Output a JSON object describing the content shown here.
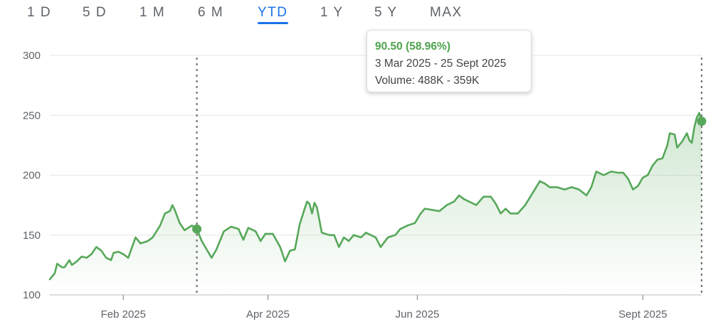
{
  "range_tabs": [
    {
      "label": "1 D"
    },
    {
      "label": "5 D"
    },
    {
      "label": "1 M"
    },
    {
      "label": "6 M"
    },
    {
      "label": "YTD"
    },
    {
      "label": "1 Y"
    },
    {
      "label": "5 Y"
    },
    {
      "label": "MAX"
    }
  ],
  "active_tab": "YTD",
  "tooltip": {
    "change": "90.50 (58.96%)",
    "date_range": "3 Mar 2025 - 25 Sept 2025",
    "volume": "Volume: 488K - 359K"
  },
  "colors": {
    "line": "#57a85a",
    "fill": "#57a85a",
    "accent": "#1a73e8",
    "grid": "#e6e6e6",
    "marker_line": "#757575"
  },
  "chart_data": {
    "type": "area",
    "title": "",
    "xlabel": "",
    "ylabel": "",
    "ylim": [
      100,
      300
    ],
    "yticks": [
      100,
      150,
      200,
      250,
      300
    ],
    "xlim": [
      "2025-01-02",
      "2025-09-25"
    ],
    "xticks": [
      {
        "date": "2025-02-01",
        "label": "Feb 2025"
      },
      {
        "date": "2025-04-01",
        "label": "Apr 2025"
      },
      {
        "date": "2025-06-01",
        "label": "Jun 2025"
      },
      {
        "date": "2025-09-01",
        "label": "Sept 2025"
      }
    ],
    "grid": true,
    "selection": {
      "start": "2025-03-03",
      "end": "2025-09-25"
    },
    "series": [
      {
        "points": [
          [
            "2025-01-02",
            113
          ],
          [
            "2025-01-04",
            118
          ],
          [
            "2025-01-05",
            126
          ],
          [
            "2025-01-07",
            123
          ],
          [
            "2025-01-08",
            123
          ],
          [
            "2025-01-10",
            129
          ],
          [
            "2025-01-11",
            125
          ],
          [
            "2025-01-13",
            128
          ],
          [
            "2025-01-15",
            132
          ],
          [
            "2025-01-17",
            131
          ],
          [
            "2025-01-19",
            134
          ],
          [
            "2025-01-21",
            140
          ],
          [
            "2025-01-23",
            137
          ],
          [
            "2025-01-25",
            131
          ],
          [
            "2025-01-27",
            129
          ],
          [
            "2025-01-28",
            135
          ],
          [
            "2025-01-30",
            136
          ],
          [
            "2025-02-01",
            134
          ],
          [
            "2025-02-03",
            131
          ],
          [
            "2025-02-06",
            148
          ],
          [
            "2025-02-08",
            143
          ],
          [
            "2025-02-11",
            145
          ],
          [
            "2025-02-13",
            148
          ],
          [
            "2025-02-16",
            158
          ],
          [
            "2025-02-18",
            168
          ],
          [
            "2025-02-20",
            170
          ],
          [
            "2025-02-21",
            175
          ],
          [
            "2025-02-22",
            171
          ],
          [
            "2025-02-24",
            160
          ],
          [
            "2025-02-26",
            154
          ],
          [
            "2025-03-01",
            158
          ],
          [
            "2025-03-03",
            155
          ],
          [
            "2025-03-05",
            145
          ],
          [
            "2025-03-07",
            138
          ],
          [
            "2025-03-09",
            131
          ],
          [
            "2025-03-11",
            138
          ],
          [
            "2025-03-14",
            153
          ],
          [
            "2025-03-17",
            157
          ],
          [
            "2025-03-20",
            155
          ],
          [
            "2025-03-22",
            146
          ],
          [
            "2025-03-24",
            156
          ],
          [
            "2025-03-27",
            153
          ],
          [
            "2025-03-29",
            145
          ],
          [
            "2025-03-31",
            151
          ],
          [
            "2025-04-03",
            151
          ],
          [
            "2025-04-06",
            140
          ],
          [
            "2025-04-08",
            128
          ],
          [
            "2025-04-10",
            137
          ],
          [
            "2025-04-12",
            138
          ],
          [
            "2025-04-14",
            159
          ],
          [
            "2025-04-16",
            172
          ],
          [
            "2025-04-17",
            178
          ],
          [
            "2025-04-18",
            176
          ],
          [
            "2025-04-19",
            168
          ],
          [
            "2025-04-20",
            177
          ],
          [
            "2025-04-21",
            173
          ],
          [
            "2025-04-23",
            152
          ],
          [
            "2025-04-26",
            150
          ],
          [
            "2025-04-28",
            150
          ],
          [
            "2025-04-30",
            140
          ],
          [
            "2025-05-02",
            148
          ],
          [
            "2025-05-04",
            145
          ],
          [
            "2025-05-06",
            150
          ],
          [
            "2025-05-09",
            148
          ],
          [
            "2025-05-11",
            152
          ],
          [
            "2025-05-13",
            150
          ],
          [
            "2025-05-15",
            148
          ],
          [
            "2025-05-17",
            140
          ],
          [
            "2025-05-20",
            148
          ],
          [
            "2025-05-23",
            150
          ],
          [
            "2025-05-25",
            155
          ],
          [
            "2025-05-28",
            158
          ],
          [
            "2025-05-31",
            160
          ],
          [
            "2025-06-02",
            167
          ],
          [
            "2025-06-04",
            172
          ],
          [
            "2025-06-07",
            171
          ],
          [
            "2025-06-10",
            170
          ],
          [
            "2025-06-13",
            175
          ],
          [
            "2025-06-16",
            178
          ],
          [
            "2025-06-18",
            183
          ],
          [
            "2025-06-20",
            180
          ],
          [
            "2025-06-22",
            178
          ],
          [
            "2025-06-25",
            175
          ],
          [
            "2025-06-28",
            182
          ],
          [
            "2025-07-01",
            182
          ],
          [
            "2025-07-03",
            176
          ],
          [
            "2025-07-05",
            168
          ],
          [
            "2025-07-07",
            172
          ],
          [
            "2025-07-09",
            168
          ],
          [
            "2025-07-12",
            168
          ],
          [
            "2025-07-15",
            175
          ],
          [
            "2025-07-18",
            185
          ],
          [
            "2025-07-21",
            195
          ],
          [
            "2025-07-23",
            193
          ],
          [
            "2025-07-25",
            190
          ],
          [
            "2025-07-28",
            190
          ],
          [
            "2025-07-31",
            188
          ],
          [
            "2025-08-03",
            190
          ],
          [
            "2025-08-06",
            188
          ],
          [
            "2025-08-09",
            183
          ],
          [
            "2025-08-11",
            190
          ],
          [
            "2025-08-13",
            203
          ],
          [
            "2025-08-16",
            200
          ],
          [
            "2025-08-19",
            203
          ],
          [
            "2025-08-22",
            202
          ],
          [
            "2025-08-24",
            202
          ],
          [
            "2025-08-26",
            197
          ],
          [
            "2025-08-28",
            188
          ],
          [
            "2025-08-30",
            191
          ],
          [
            "2025-09-01",
            198
          ],
          [
            "2025-09-03",
            200
          ],
          [
            "2025-09-05",
            208
          ],
          [
            "2025-09-07",
            213
          ],
          [
            "2025-09-09",
            214
          ],
          [
            "2025-09-11",
            225
          ],
          [
            "2025-09-12",
            235
          ],
          [
            "2025-09-14",
            234
          ],
          [
            "2025-09-15",
            223
          ],
          [
            "2025-09-17",
            228
          ],
          [
            "2025-09-19",
            235
          ],
          [
            "2025-09-20",
            229
          ],
          [
            "2025-09-21",
            227
          ],
          [
            "2025-09-22",
            240
          ],
          [
            "2025-09-23",
            248
          ],
          [
            "2025-09-24",
            252
          ],
          [
            "2025-09-25",
            245
          ]
        ]
      }
    ]
  }
}
